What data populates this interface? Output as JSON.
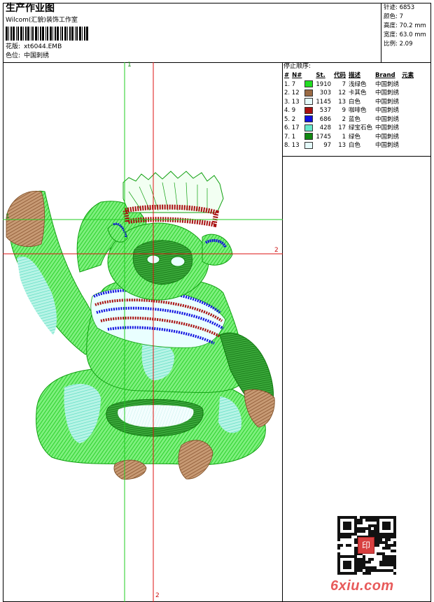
{
  "header": {
    "title": "生产作业图",
    "software": "Wilcom(汇貌)装饰工作室",
    "design_label": "花版:",
    "design_value": "xt6044.EMB",
    "color_label": "色位:",
    "color_value": "中国刺绣"
  },
  "stats": {
    "stitches": "针迹: 6853",
    "colors": "颜色: 7",
    "height": "高度: 70.2 mm",
    "width": "宽度: 63.0 mm",
    "ratio": "比例: 2.09"
  },
  "sequence": {
    "heading": "停止顺序:",
    "columns": [
      "#",
      "N#",
      "St.",
      "代码",
      "描述",
      "Brand",
      "元素"
    ],
    "rows": [
      {
        "idx": "1. 7",
        "color": "#22dd22",
        "st": "1910",
        "code": "7",
        "desc": "浅绿色",
        "brand": "中国刺绣"
      },
      {
        "idx": "2. 12",
        "color": "#9a6a44",
        "st": "303",
        "code": "12",
        "desc": "卡其色",
        "brand": "中国刺绣"
      },
      {
        "idx": "3. 13",
        "color": "#e4fafa",
        "st": "1145",
        "code": "13",
        "desc": "白色",
        "brand": "中国刺绣"
      },
      {
        "idx": "4. 9",
        "color": "#a81010",
        "st": "537",
        "code": "9",
        "desc": "咖啡色",
        "brand": "中国刺绣"
      },
      {
        "idx": "5. 2",
        "color": "#1010e0",
        "st": "686",
        "code": "2",
        "desc": "蓝色",
        "brand": "中国刺绣"
      },
      {
        "idx": "6. 17",
        "color": "#66e8cc",
        "st": "428",
        "code": "17",
        "desc": "绿宝石色",
        "brand": "中国刺绣"
      },
      {
        "idx": "7. 1",
        "color": "#118811",
        "st": "1745",
        "code": "1",
        "desc": "绿色",
        "brand": "中国刺绣"
      },
      {
        "idx": "8. 13",
        "color": "#e4fafa",
        "st": "97",
        "code": "13",
        "desc": "白色",
        "brand": "中国刺绣"
      }
    ]
  },
  "guides": {
    "green_top": "1",
    "green_left": "1",
    "red_right": "2",
    "red_bottom": "2"
  },
  "watermark": {
    "text": "6xiu.com",
    "seal": "印"
  }
}
